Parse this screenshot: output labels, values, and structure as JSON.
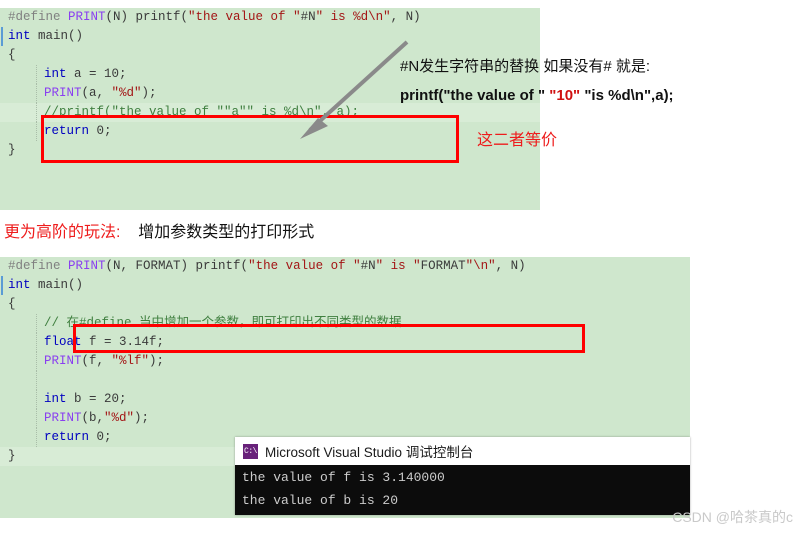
{
  "code_block_1": {
    "name": "stringify-macro-example",
    "background": "#cfe7cd",
    "lines": [
      {
        "segments": [
          {
            "cls": "tok-pre",
            "t": "#define "
          },
          {
            "cls": "tok-macro",
            "t": "PRINT"
          },
          {
            "cls": "tok-plain",
            "t": "(N) printf("
          },
          {
            "cls": "tok-str",
            "t": "\"the value of \""
          },
          {
            "cls": "tok-plain",
            "t": "#N"
          },
          {
            "cls": "tok-str",
            "t": "\" is %d\\n\""
          },
          {
            "cls": "tok-plain",
            "t": ", N)"
          }
        ]
      },
      {
        "marginbar": true,
        "segments": [
          {
            "cls": "tok-kw",
            "t": "int "
          },
          {
            "cls": "tok-plain",
            "t": "main()"
          }
        ]
      },
      {
        "segments": [
          {
            "cls": "tok-plain",
            "t": "{"
          }
        ]
      },
      {
        "guide": true,
        "indent": true,
        "segments": [
          {
            "cls": "tok-kw",
            "t": "int "
          },
          {
            "cls": "tok-plain",
            "t": "a = "
          },
          {
            "cls": "tok-num",
            "t": "10"
          },
          {
            "cls": "tok-plain",
            "t": ";"
          }
        ]
      },
      {
        "guide": true,
        "indent": true,
        "segments": [
          {
            "cls": "tok-macro",
            "t": "PRINT"
          },
          {
            "cls": "tok-plain",
            "t": "(a, "
          },
          {
            "cls": "tok-str",
            "t": "\"%d\""
          },
          {
            "cls": "tok-plain",
            "t": ");"
          }
        ]
      },
      {
        "guide": true,
        "indent": true,
        "highlight": true,
        "segments": [
          {
            "cls": "tok-comment",
            "t": "//printf(\"the value of \"\"a\"\" is %d\\n\", a);"
          }
        ]
      },
      {
        "guide": true,
        "indent": true,
        "segments": [
          {
            "cls": "tok-kw",
            "t": "return "
          },
          {
            "cls": "tok-num",
            "t": "0"
          },
          {
            "cls": "tok-plain",
            "t": ";"
          }
        ]
      },
      {
        "segments": [
          {
            "cls": "tok-plain",
            "t": "}"
          }
        ]
      }
    ]
  },
  "code_block_2": {
    "name": "format-param-macro-example",
    "background": "#cfe7cd",
    "lines": [
      {
        "segments": [
          {
            "cls": "tok-pre",
            "t": "#define "
          },
          {
            "cls": "tok-macro",
            "t": "PRINT"
          },
          {
            "cls": "tok-plain",
            "t": "(N, FORMAT) printf("
          },
          {
            "cls": "tok-str",
            "t": "\"the value of \""
          },
          {
            "cls": "tok-plain",
            "t": "#N"
          },
          {
            "cls": "tok-str",
            "t": "\" is \""
          },
          {
            "cls": "tok-plain",
            "t": "FORMAT"
          },
          {
            "cls": "tok-str",
            "t": "\"\\n\""
          },
          {
            "cls": "tok-plain",
            "t": ", N)"
          }
        ]
      },
      {
        "marginbar": true,
        "segments": [
          {
            "cls": "tok-kw",
            "t": "int "
          },
          {
            "cls": "tok-plain",
            "t": "main()"
          }
        ]
      },
      {
        "segments": [
          {
            "cls": "tok-plain",
            "t": "{"
          }
        ]
      },
      {
        "guide": true,
        "indent": true,
        "segments": [
          {
            "cls": "tok-comment",
            "t": "// 在#define 当中增加一个参数，即可打印出不同类型的数据"
          }
        ]
      },
      {
        "guide": true,
        "indent": true,
        "segments": [
          {
            "cls": "tok-kw",
            "t": "float "
          },
          {
            "cls": "tok-plain",
            "t": "f = "
          },
          {
            "cls": "tok-num",
            "t": "3.14f"
          },
          {
            "cls": "tok-plain",
            "t": ";"
          }
        ]
      },
      {
        "guide": true,
        "indent": true,
        "segments": [
          {
            "cls": "tok-macro",
            "t": "PRINT"
          },
          {
            "cls": "tok-plain",
            "t": "(f, "
          },
          {
            "cls": "tok-str",
            "t": "\"%lf\""
          },
          {
            "cls": "tok-plain",
            "t": ");"
          }
        ]
      },
      {
        "guide": true,
        "indent": true,
        "segments": [
          {
            "cls": "tok-plain",
            "t": ""
          }
        ]
      },
      {
        "guide": true,
        "indent": true,
        "segments": [
          {
            "cls": "tok-kw",
            "t": "int "
          },
          {
            "cls": "tok-plain",
            "t": "b = "
          },
          {
            "cls": "tok-num",
            "t": "20"
          },
          {
            "cls": "tok-plain",
            "t": ";"
          }
        ]
      },
      {
        "guide": true,
        "indent": true,
        "segments": [
          {
            "cls": "tok-macro",
            "t": "PRINT"
          },
          {
            "cls": "tok-plain",
            "t": "(b,"
          },
          {
            "cls": "tok-str",
            "t": "\"%d\""
          },
          {
            "cls": "tok-plain",
            "t": ");"
          }
        ]
      },
      {
        "guide": true,
        "indent": true,
        "segments": [
          {
            "cls": "tok-kw",
            "t": "return "
          },
          {
            "cls": "tok-num",
            "t": "0"
          },
          {
            "cls": "tok-plain",
            "t": ";"
          }
        ]
      },
      {
        "highlight": true,
        "segments": [
          {
            "cls": "tok-plain",
            "t": "}"
          }
        ]
      }
    ]
  },
  "annotations": {
    "note_line_1": "#N发生字符串的替换 如果没有# 就是:",
    "note_line_2_prefix": "printf(\"the value of \" ",
    "note_line_2_red": "\"10\"",
    "note_line_2_suffix": " \"is %d\\n\",a);",
    "equivalence_note": "这二者等价",
    "heading_red": "更为高阶的玩法:",
    "heading_black": "增加参数类型的打印形式",
    "arrow_color": "#8a8a8a",
    "highlight_box_color": "#ff0000",
    "red_text_color": "#ee1c1c"
  },
  "console": {
    "icon_label": "C:\\",
    "title": "Microsoft Visual Studio 调试控制台",
    "output_lines": [
      "the value of f is 3.140000",
      "the value of b is 20"
    ],
    "background": "#0c0c0c",
    "text_color": "#cccccc"
  },
  "watermark": {
    "text": "CSDN @哈茶真的c"
  }
}
